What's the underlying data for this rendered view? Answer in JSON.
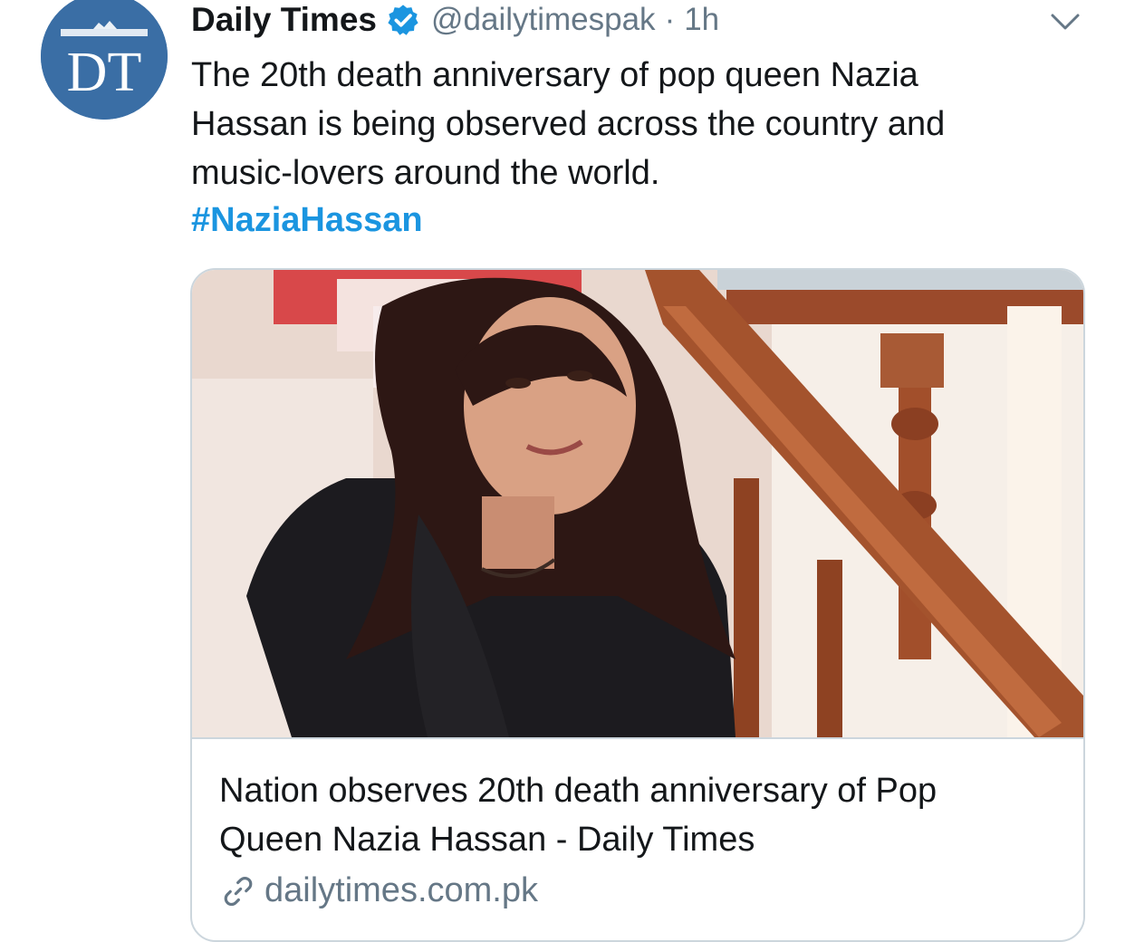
{
  "tweet": {
    "author": {
      "avatar_text": "DT",
      "display_name": "Daily Times",
      "verified_icon": "verified-badge-icon",
      "handle": "@dailytimespak",
      "separator": "·",
      "time": "1h"
    },
    "menu_icon": "chevron-down-icon",
    "text_lines": [
      "The 20th death anniversary of pop queen Nazia",
      "Hassan is being observed across the country and",
      "music-lovers around the world."
    ],
    "hashtag": "#NaziaHassan",
    "card": {
      "image_icon": "photo-woman-staircase",
      "title_lines": [
        "Nation observes 20th death anniversary of Pop",
        "Queen Nazia Hassan - Daily Times"
      ],
      "link_icon": "link-icon",
      "domain": "dailytimes.com.pk"
    },
    "colors": {
      "link_blue": "#1b95e0",
      "secondary_gray": "#657786",
      "avatar_blue": "#3a6ea5",
      "border": "#ccd6dd"
    }
  }
}
